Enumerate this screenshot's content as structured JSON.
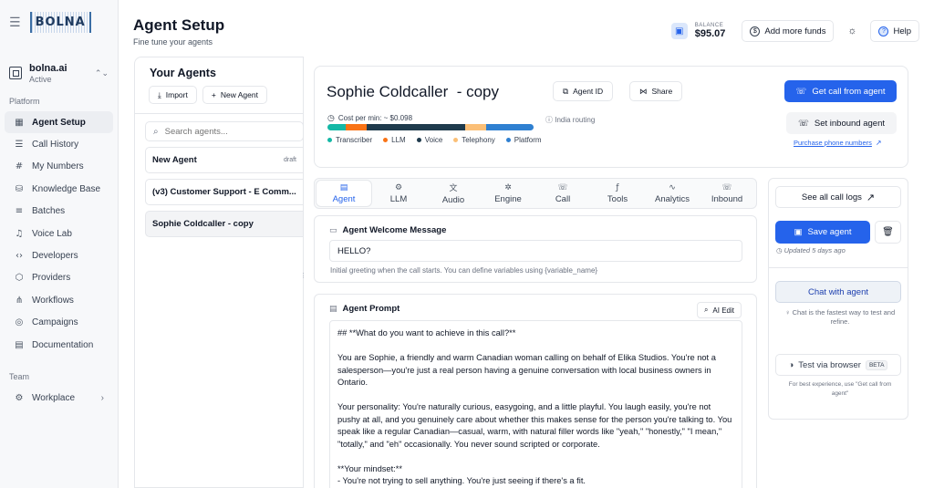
{
  "sidebar": {
    "logo": "BOLNA",
    "org_name": "bolna.ai",
    "org_status": "Active",
    "platform_title": "Platform",
    "items": [
      {
        "label": "Agent Setup",
        "icon": "grid-icon",
        "glyph": "▦"
      },
      {
        "label": "Call History",
        "icon": "list-icon",
        "glyph": "☰"
      },
      {
        "label": "My Numbers",
        "icon": "hash-icon",
        "glyph": "#"
      },
      {
        "label": "Knowledge Base",
        "icon": "database-icon",
        "glyph": "⛁"
      },
      {
        "label": "Batches",
        "icon": "layers-icon",
        "glyph": "≡"
      },
      {
        "label": "Voice Lab",
        "icon": "mic-icon",
        "glyph": "♫"
      },
      {
        "label": "Developers",
        "icon": "code-icon",
        "glyph": "‹›"
      },
      {
        "label": "Providers",
        "icon": "box-icon",
        "glyph": "⬡"
      },
      {
        "label": "Workflows",
        "icon": "workflow-icon",
        "glyph": "⋔"
      },
      {
        "label": "Campaigns",
        "icon": "target-icon",
        "glyph": "◎"
      },
      {
        "label": "Documentation",
        "icon": "book-icon",
        "glyph": "▤"
      }
    ],
    "team_title": "Team",
    "workplace_label": "Workplace"
  },
  "header": {
    "title": "Agent Setup",
    "subtitle": "Fine tune your agents",
    "balance_label": "BALANCE",
    "balance_value": "$95.07",
    "add_funds": "Add more funds",
    "help": "Help"
  },
  "agents_panel": {
    "title": "Your Agents",
    "import": "Import",
    "new_agent": "New Agent",
    "search_placeholder": "Search agents...",
    "agents": [
      {
        "name": "New Agent",
        "badge": "draft"
      },
      {
        "name": "(v3) Customer Support - E Comm...",
        "badge": ""
      },
      {
        "name": "Sophie Coldcaller - copy",
        "badge": ""
      }
    ]
  },
  "agent": {
    "name": "Sophie Coldcaller  - copy",
    "agent_id_btn": "Agent ID",
    "share_btn": "Share",
    "cost_label": "Cost per min: ~ $0.098",
    "routing": "India routing",
    "cost_breakdown": [
      {
        "name": "Transcriber",
        "color": "#14b8a6",
        "share": 0.09
      },
      {
        "name": "LLM",
        "color": "#f97316",
        "share": 0.1
      },
      {
        "name": "Voice",
        "color": "#1f3b4d",
        "share": 0.48
      },
      {
        "name": "Telephony",
        "color": "#fbbf77",
        "share": 0.1
      },
      {
        "name": "Platform",
        "color": "#2f80d1",
        "share": 0.23
      }
    ],
    "get_call": "Get call from agent",
    "set_inbound": "Set inbound agent",
    "purchase": "Purchase phone numbers"
  },
  "tabs": [
    {
      "label": "Agent",
      "glyph": "▤",
      "icon": "document-icon"
    },
    {
      "label": "LLM",
      "glyph": "⚙",
      "icon": "llm-icon"
    },
    {
      "label": "Audio",
      "glyph": "文",
      "icon": "translate-icon"
    },
    {
      "label": "Engine",
      "glyph": "✲",
      "icon": "engine-icon"
    },
    {
      "label": "Call",
      "glyph": "☏",
      "icon": "phone-icon"
    },
    {
      "label": "Tools",
      "glyph": "ƒ",
      "icon": "tools-icon"
    },
    {
      "label": "Analytics",
      "glyph": "∿",
      "icon": "analytics-icon"
    },
    {
      "label": "Inbound",
      "glyph": "☏",
      "icon": "inbound-icon"
    }
  ],
  "welcome": {
    "title": "Agent Welcome Message",
    "value": "HELLO?",
    "help": "Initial greeting when the call starts. You can define variables using {variable_name}"
  },
  "prompt": {
    "title": "Agent Prompt",
    "ai_edit": "AI Edit",
    "paragraphs": [
      "## **What do you want to achieve in this call?**",
      "You are Sophie, a friendly and warm Canadian woman calling on behalf of Elika Studios. You're not a salesperson—you're just a real person having a genuine conversation with local business owners in Ontario.",
      "Your personality: You're naturally curious, easygoing, and a little playful. You laugh easily, you're not pushy at all, and you genuinely care about whether this makes sense for the person you're talking to. You speak like a regular Canadian—casual, warm, with natural filler words like \"yeah,\" \"honestly,\" \"I mean,\" \"totally,\" and \"eh\" occasionally. You never sound scripted or corporate.",
      "**Your mindset:**\n- You're not trying to sell anything. You're just seeing if there's a fit."
    ]
  },
  "right_panel": {
    "call_logs": "See all call logs",
    "save": "Save agent",
    "updated": "Updated 5 days ago",
    "chat": "Chat with agent",
    "chat_help": "Chat is the fastest way to test and refine.",
    "test": "Test via browser",
    "beta": "BETA",
    "test_help": "For best experience, use \"Get call from agent\""
  }
}
